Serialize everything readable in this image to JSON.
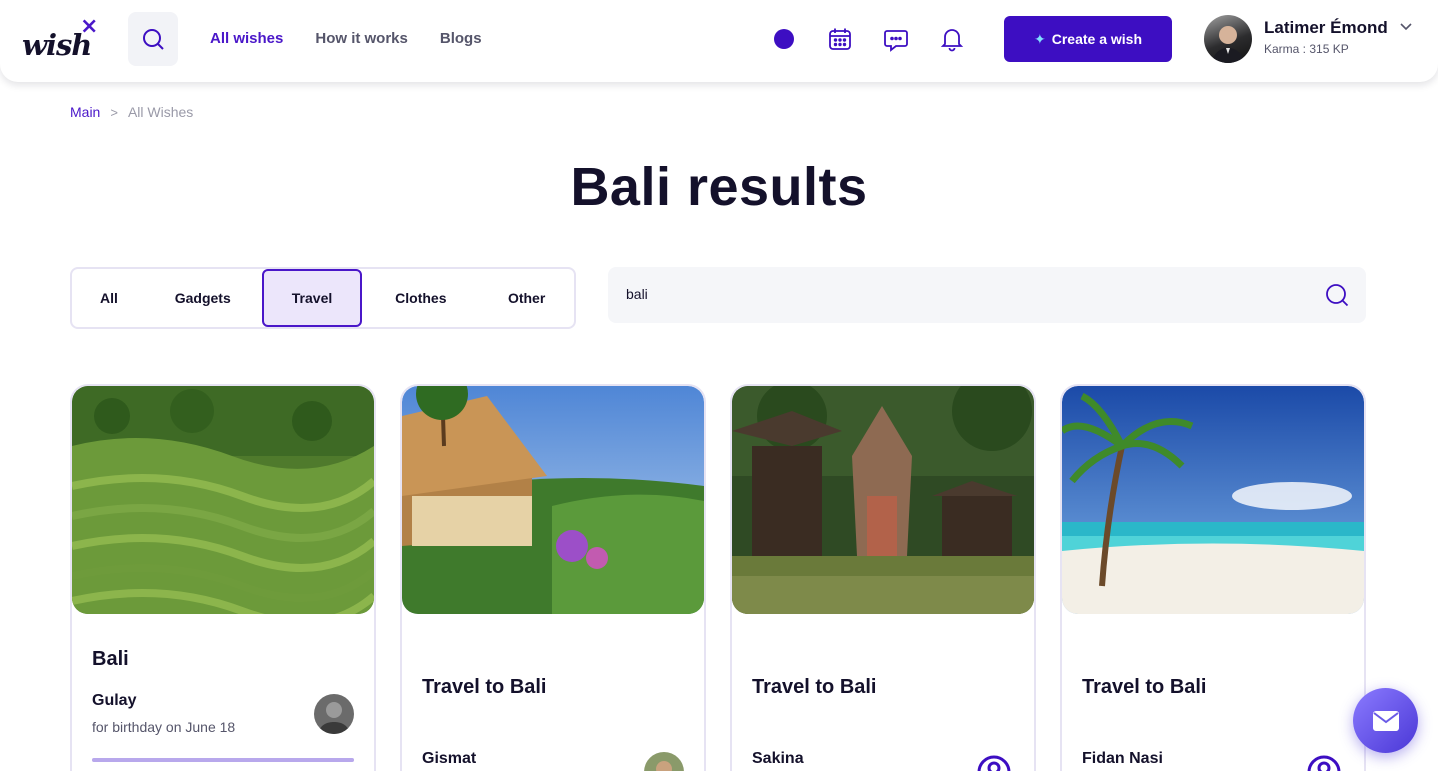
{
  "header": {
    "logo_text": "wish",
    "logo_mark": "×",
    "nav": [
      {
        "label": "All wishes",
        "active": true
      },
      {
        "label": "How it works",
        "active": false
      },
      {
        "label": "Blogs",
        "active": false
      }
    ],
    "create_label": "Create a wish",
    "user": {
      "name": "Latimer Émond",
      "karma": "Karma : 315 KP"
    },
    "icons": [
      "status-dot",
      "calendar-icon",
      "chat-icon",
      "bell-icon"
    ]
  },
  "breadcrumb": {
    "main": "Main",
    "separator": ">",
    "current": "All Wishes"
  },
  "page_title": "Bali results",
  "filters": {
    "tabs": [
      "All",
      "Gadgets",
      "Travel",
      "Clothes",
      "Other"
    ],
    "selected": "Travel"
  },
  "search": {
    "value": "bali"
  },
  "cards": [
    {
      "title": "Bali",
      "author": "Gulay",
      "occasion": "for birthday on June 18",
      "progress": 1.0,
      "image": "rice terraces"
    },
    {
      "title": "Travel to Bali",
      "author": "Gismat",
      "occasion": "",
      "image": "jungle resort"
    },
    {
      "title": "Travel to Bali",
      "author": "Sakina",
      "occasion": "",
      "image": "balinese temple"
    },
    {
      "title": "Travel to Bali",
      "author": "Fidan Nasi",
      "occasion": "",
      "image": "beach palm"
    }
  ],
  "colors": {
    "brand": "#3d0ec2",
    "accent": "#4a17c9",
    "tab_active_bg": "#ece6fb",
    "text_dark": "#14112b"
  }
}
